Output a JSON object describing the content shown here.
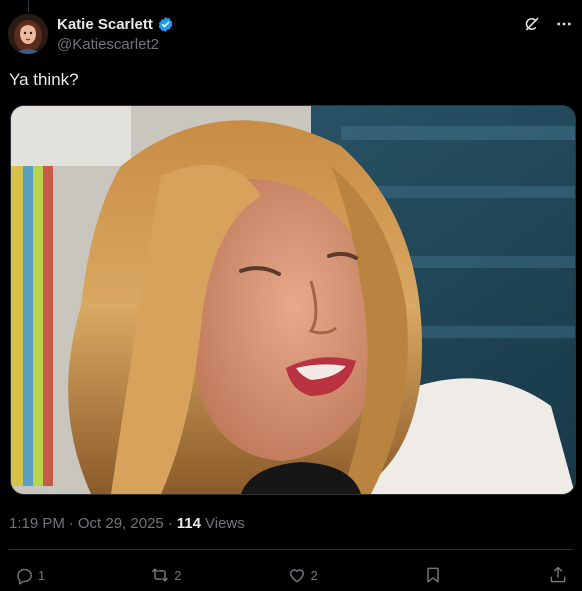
{
  "post": {
    "author": {
      "display_name": "Katie Scarlett",
      "handle": "@Katiescarlet2",
      "verified": true
    },
    "text": "Ya think?",
    "timestamp": {
      "time": "1:19 PM",
      "separator": "·",
      "date": "Oct 29, 2025",
      "views_separator": "·",
      "views_count": "114",
      "views_label": "Views"
    },
    "media": {
      "kind": "video-still",
      "alt_visible": false
    },
    "actions": {
      "reply_count": "1",
      "repost_count": "2",
      "like_count": "2"
    }
  },
  "icons": {
    "verified": "verified-badge-icon",
    "grok": "grok-icon",
    "more": "more-icon",
    "reply": "reply-icon",
    "repost": "repost-icon",
    "like": "heart-icon",
    "bookmark": "bookmark-icon",
    "share": "share-icon"
  },
  "colors": {
    "background": "#000000",
    "text": "#e7e9ea",
    "muted": "#71767b",
    "verified": "#1d9bf0",
    "divider": "#2f3336"
  }
}
